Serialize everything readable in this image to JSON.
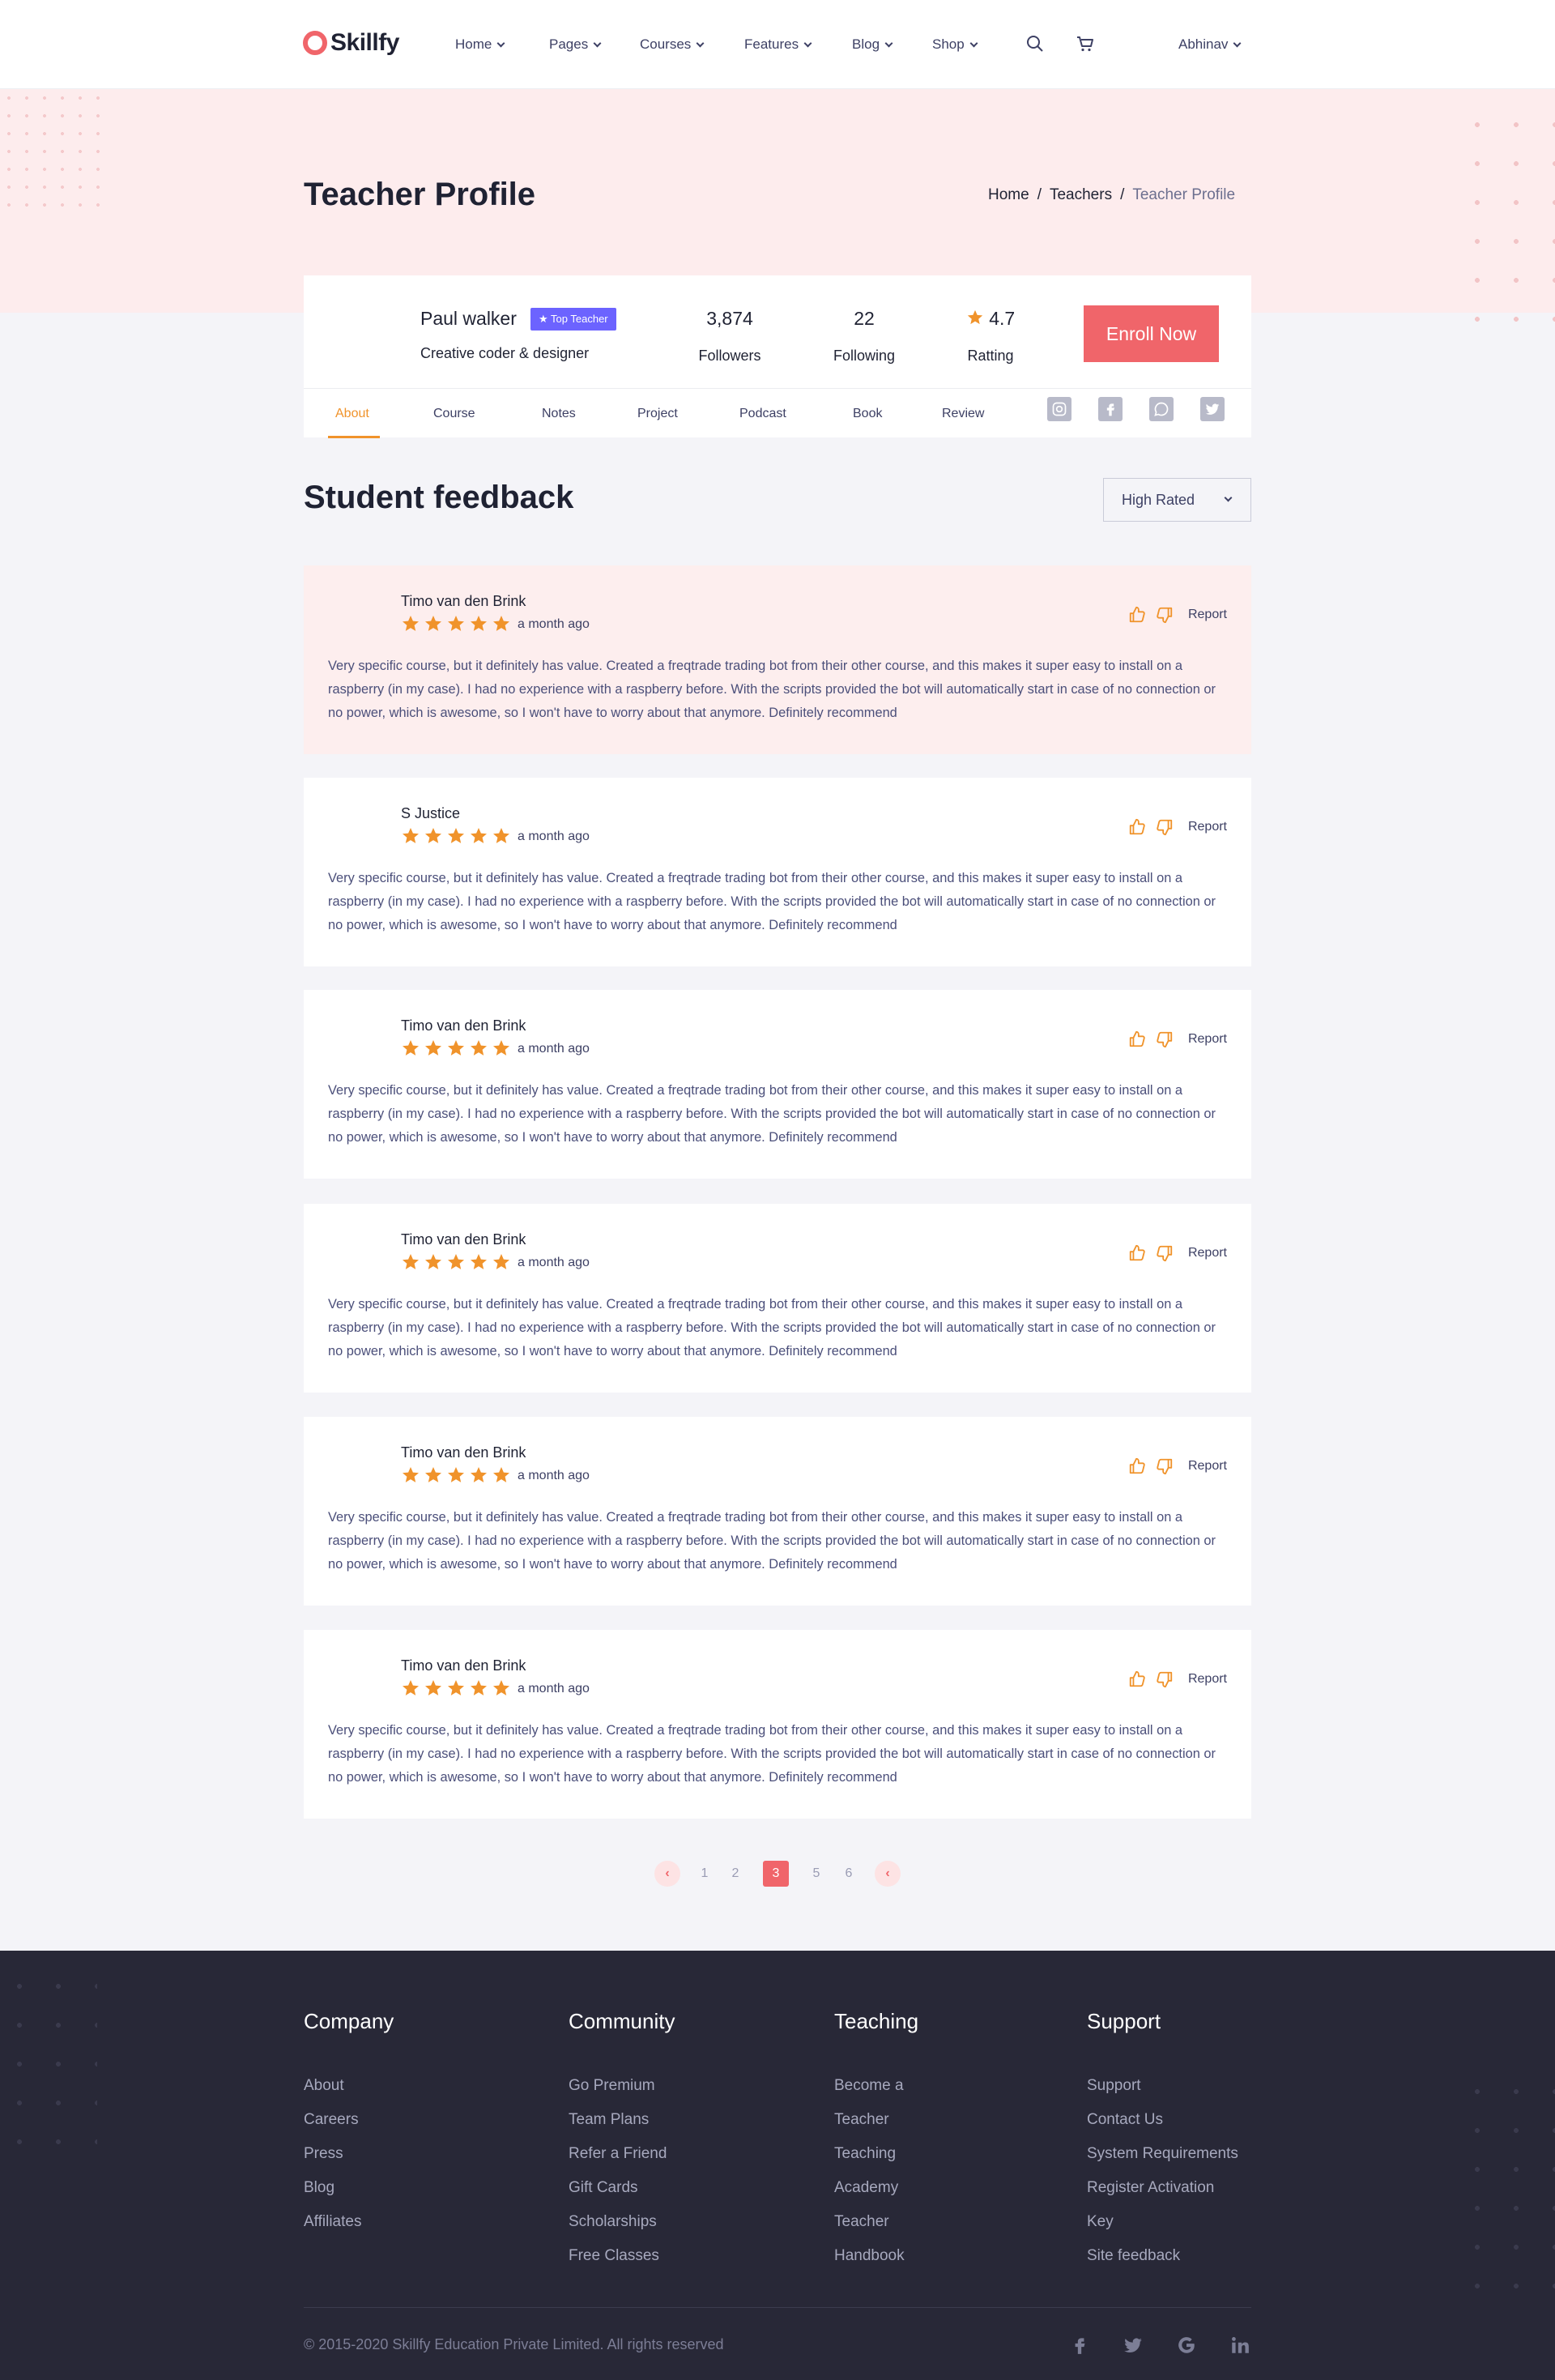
{
  "brand": {
    "name": "Skillfy",
    "accent": "#f0656a",
    "badge_color": "#6c63ff",
    "star_color": "#f0932b"
  },
  "nav": {
    "items": [
      "Home",
      "Pages",
      "Courses",
      "Features",
      "Blog",
      "Shop"
    ],
    "user": "Abhinav"
  },
  "header": {
    "title": "Teacher Profile",
    "breadcrumb": [
      "Home",
      "Teachers",
      "Teacher Profile"
    ]
  },
  "profile": {
    "name": "Paul walker",
    "badge": "Top Teacher",
    "role": "Creative coder & designer",
    "stats": [
      {
        "value": "3,874",
        "label": "Followers"
      },
      {
        "value": "22",
        "label": "Following"
      },
      {
        "value": "4.7",
        "label": "Ratting"
      }
    ],
    "enroll_label": "Enroll Now"
  },
  "tabs": [
    "About",
    "Course",
    "Notes",
    "Project",
    "Podcast",
    "Book",
    "Review"
  ],
  "social_icons": [
    "instagram-icon",
    "facebook-icon",
    "whatsapp-icon",
    "twitter-icon"
  ],
  "feedback": {
    "title": "Student feedback",
    "sort": "High Rated",
    "report_label": "Report",
    "reviews": [
      {
        "name": "Timo van den Brink",
        "rating": 5,
        "date": "a month ago",
        "text": "Very specific course, but it definitely has value. Created a freqtrade trading bot from their other course, and this makes it super easy to install on a raspberry (in my case). I had no experience with a raspberry before. With the scripts provided the bot will automatically start in case of no connection or no power, which is awesome, so I won't have to worry about that anymore. Definitely recommend"
      },
      {
        "name": "S Justice",
        "rating": 5,
        "date": "a month ago",
        "text": "Very specific course, but it definitely has value. Created a freqtrade trading bot from their other course, and this makes it super easy to install on a raspberry (in my case). I had no experience with a raspberry before. With the scripts provided the bot will automatically start in case of no connection or no power, which is awesome, so I won't have to worry about that anymore. Definitely recommend"
      },
      {
        "name": "Timo van den Brink",
        "rating": 5,
        "date": "a month ago",
        "text": "Very specific course, but it definitely has value. Created a freqtrade trading bot from their other course, and this makes it super easy to install on a raspberry (in my case). I had no experience with a raspberry before. With the scripts provided the bot will automatically start in case of no connection or no power, which is awesome, so I won't have to worry about that anymore. Definitely recommend"
      },
      {
        "name": "Timo van den Brink",
        "rating": 5,
        "date": "a month ago",
        "text": "Very specific course, but it definitely has value. Created a freqtrade trading bot from their other course, and this makes it super easy to install on a raspberry (in my case). I had no experience with a raspberry before. With the scripts provided the bot will automatically start in case of no connection or no power, which is awesome, so I won't have to worry about that anymore. Definitely recommend"
      },
      {
        "name": "Timo van den Brink",
        "rating": 5,
        "date": "a month ago",
        "text": "Very specific course, but it definitely has value. Created a freqtrade trading bot from their other course, and this makes it super easy to install on a raspberry (in my case). I had no experience with a raspberry before. With the scripts provided the bot will automatically start in case of no connection or no power, which is awesome, so I won't have to worry about that anymore. Definitely recommend"
      },
      {
        "name": "Timo van den Brink",
        "rating": 5,
        "date": "a month ago",
        "text": "Very specific course, but it definitely has value. Created a freqtrade trading bot from their other course, and this makes it super easy to install on a raspberry (in my case). I had no experience with a raspberry before. With the scripts provided the bot will automatically start in case of no connection or no power, which is awesome, so I won't have to worry about that anymore. Definitely recommend"
      }
    ]
  },
  "pagination": {
    "pages": [
      "1",
      "2",
      "3",
      "5",
      "6"
    ],
    "current": "3"
  },
  "footer": {
    "columns": [
      {
        "title": "Company",
        "links": [
          "About",
          "Careers",
          "Press",
          "Blog",
          "Affiliates"
        ]
      },
      {
        "title": "Community",
        "links": [
          "Go Premium",
          "Team Plans",
          "Refer a Friend",
          "Gift Cards",
          "Scholarships",
          "Free Classes"
        ]
      },
      {
        "title": "Teaching",
        "links": [
          "Become a",
          "Teacher",
          "Teaching",
          "Academy",
          "Teacher",
          "Handbook"
        ]
      },
      {
        "title": "Support",
        "links": [
          "Support",
          "Contact Us",
          "System Requirements",
          "Register Activation",
          "Key",
          "Site feedback"
        ]
      }
    ],
    "copyright": "© 2015-2020 Skillfy Education Private Limited. All rights reserved",
    "social_icons": [
      "facebook-icon",
      "twitter-icon",
      "google-icon",
      "linkedin-icon"
    ]
  }
}
